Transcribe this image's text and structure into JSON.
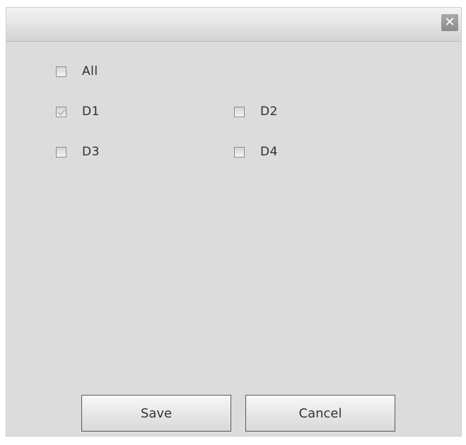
{
  "dialog": {
    "close_glyph": "✕"
  },
  "options": {
    "all": {
      "label": "All",
      "checked": false
    },
    "d1": {
      "label": "D1",
      "checked": true
    },
    "d2": {
      "label": "D2",
      "checked": false
    },
    "d3": {
      "label": "D3",
      "checked": false
    },
    "d4": {
      "label": "D4",
      "checked": false
    }
  },
  "buttons": {
    "save": "Save",
    "cancel": "Cancel"
  },
  "colors": {
    "dialog_bg": "#dcdcdc",
    "button_border": "#5a5a5a",
    "text": "#2e2e2e"
  },
  "icons": {
    "close": "close-icon",
    "checkbox": "checkbox-icon"
  }
}
